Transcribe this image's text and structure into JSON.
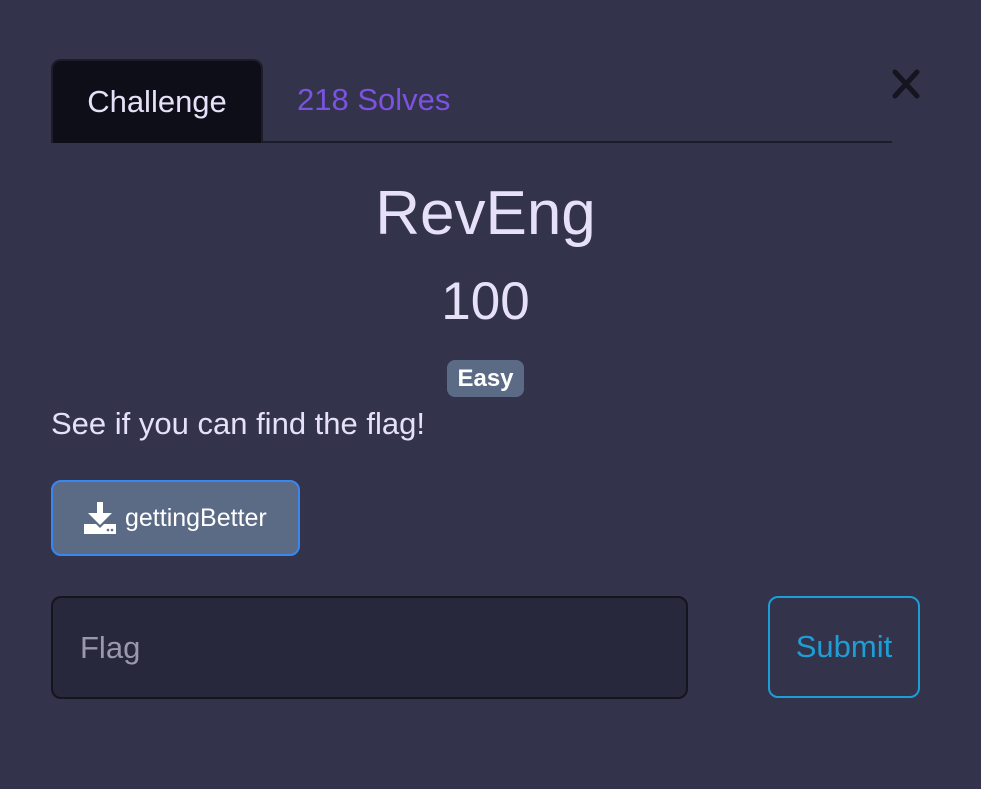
{
  "tabs": [
    {
      "label": "Challenge",
      "active": true
    },
    {
      "label": "218 Solves",
      "active": false
    }
  ],
  "close": {
    "icon": "close-icon"
  },
  "challenge": {
    "name": "RevEng",
    "value": "100",
    "difficulty": "Easy",
    "description": "See if you can find the flag!"
  },
  "files": [
    {
      "label": "gettingBetter",
      "icon": "download-icon"
    }
  ],
  "flag_form": {
    "placeholder": "Flag",
    "value": "",
    "submit_label": "Submit"
  },
  "colors": {
    "background": "#33334b",
    "active_tab": "#0e0e18",
    "solves_link": "#7c52e0",
    "badge": "#5b6b86",
    "download_border": "#3a86f0",
    "submit_accent": "#1e9ed6"
  }
}
